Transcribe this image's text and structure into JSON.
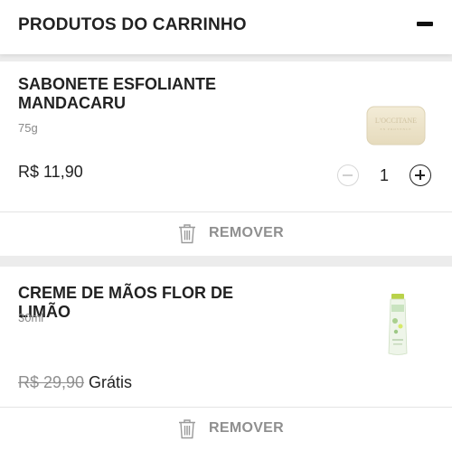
{
  "header": {
    "title": "PRODUTOS DO CARRINHO",
    "collapse_icon": "minus-icon"
  },
  "cart": {
    "items": [
      {
        "name": "SABONETE ESFOLIANTE MANDACARU",
        "size": "75g",
        "price": "R$ 11,90",
        "quantity": "1",
        "thumbnail_text": [
          "L'OCCITANE",
          "EN PROVENCE"
        ],
        "remove_label": "REMOVER"
      },
      {
        "name": "CREME DE MÃOS FLOR DE LIMÃO",
        "size": "30ml",
        "original_price": "R$ 29,90",
        "price_label": "Grátis",
        "remove_label": "REMOVER"
      }
    ]
  },
  "colors": {
    "background": "#ececec",
    "card": "#ffffff",
    "text": "#222222",
    "muted": "#8f8f8f"
  },
  "icons": {
    "remove": "trash-icon",
    "decrease": "minus-circle-icon",
    "increase": "plus-circle-icon"
  }
}
